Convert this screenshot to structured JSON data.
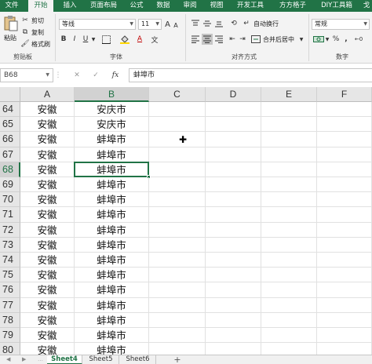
{
  "menu_tabs": [
    "文件",
    "开始",
    "插入",
    "页面布局",
    "公式",
    "数据",
    "审阅",
    "视图",
    "开发工具",
    "方方格子",
    "DIY工具箱",
    "戈"
  ],
  "active_tab_index": 1,
  "ribbon": {
    "clipboard": {
      "paste_label": "粘贴",
      "cut_label": "剪切",
      "copy_label": "复制",
      "format_painter_label": "格式刷",
      "group_label": "剪贴板"
    },
    "font": {
      "font_name": "等线",
      "font_size": "11",
      "grow_label": "A",
      "shrink_label": "A",
      "bold_label": "B",
      "italic_label": "I",
      "underline_label": "U",
      "wen_label": "文",
      "font_color_label": "A",
      "group_label": "字体"
    },
    "alignment": {
      "wrap_label": "自动换行",
      "merge_label": "合并后居中",
      "group_label": "对齐方式"
    },
    "number": {
      "format": "常规",
      "percent_label": "%",
      "comma_label": ",",
      "group_label": "数字"
    }
  },
  "formula_bar": {
    "name_box": "B68",
    "cancel_label": "✕",
    "enter_label": "✓",
    "fx_label": "fx",
    "content": "蚌埠市"
  },
  "columns": [
    "A",
    "B",
    "C",
    "D",
    "E",
    "F"
  ],
  "selected_column": "B",
  "selected_row": "68",
  "rows": [
    {
      "num": "64",
      "a": "安徽",
      "b": "安庆市"
    },
    {
      "num": "65",
      "a": "安徽",
      "b": "安庆市"
    },
    {
      "num": "66",
      "a": "安徽",
      "b": "蚌埠市"
    },
    {
      "num": "67",
      "a": "安徽",
      "b": "蚌埠市"
    },
    {
      "num": "68",
      "a": "安徽",
      "b": "蚌埠市"
    },
    {
      "num": "69",
      "a": "安徽",
      "b": "蚌埠市"
    },
    {
      "num": "70",
      "a": "安徽",
      "b": "蚌埠市"
    },
    {
      "num": "71",
      "a": "安徽",
      "b": "蚌埠市"
    },
    {
      "num": "72",
      "a": "安徽",
      "b": "蚌埠市"
    },
    {
      "num": "73",
      "a": "安徽",
      "b": "蚌埠市"
    },
    {
      "num": "74",
      "a": "安徽",
      "b": "蚌埠市"
    },
    {
      "num": "75",
      "a": "安徽",
      "b": "蚌埠市"
    },
    {
      "num": "76",
      "a": "安徽",
      "b": "蚌埠市"
    },
    {
      "num": "77",
      "a": "安徽",
      "b": "蚌埠市"
    },
    {
      "num": "78",
      "a": "安徽",
      "b": "蚌埠市"
    },
    {
      "num": "79",
      "a": "安徽",
      "b": "蚌埠市"
    },
    {
      "num": "80",
      "a": "安徽",
      "b": "蚌埠市"
    }
  ],
  "sheets": [
    "Sheet4",
    "Sheet5",
    "Sheet6"
  ],
  "active_sheet_index": 0,
  "add_sheet_label": "+",
  "colors": {
    "accent": "#217346",
    "ribbon_bg": "#f3f3f3",
    "header_bg": "#e6e6e6"
  }
}
